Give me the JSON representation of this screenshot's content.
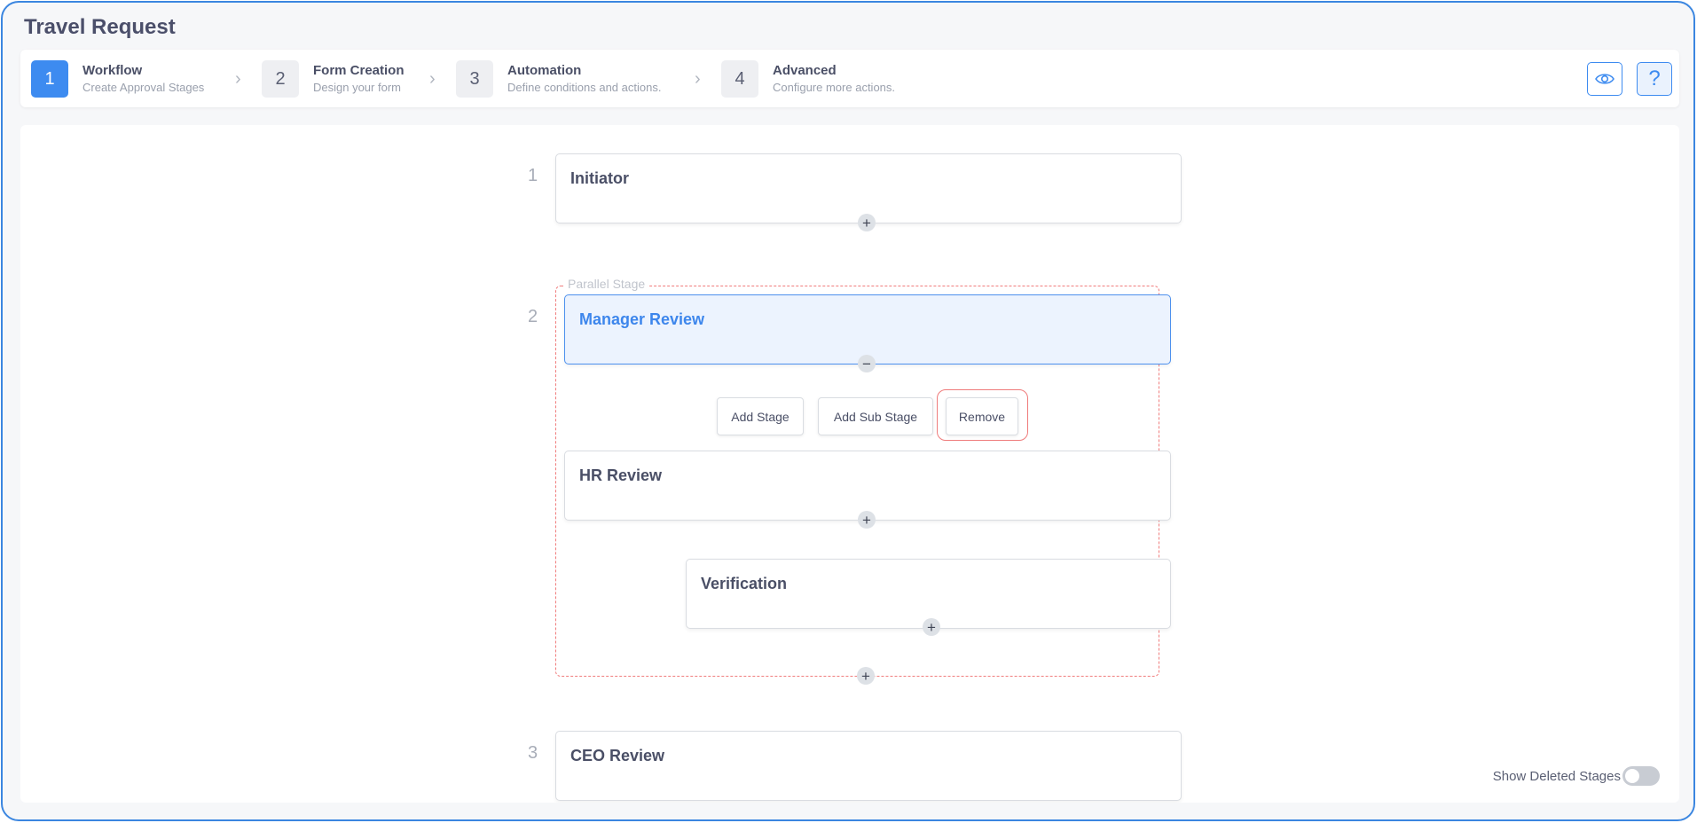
{
  "header": {
    "title": "Travel Request"
  },
  "stepper": {
    "steps": [
      {
        "num": "1",
        "title": "Workflow",
        "subtitle": "Create Approval Stages",
        "active": true
      },
      {
        "num": "2",
        "title": "Form Creation",
        "subtitle": "Design your form",
        "active": false
      },
      {
        "num": "3",
        "title": "Automation",
        "subtitle": "Define conditions and actions.",
        "active": false
      },
      {
        "num": "4",
        "title": "Advanced",
        "subtitle": "Configure more actions.",
        "active": false
      }
    ],
    "chevron": "›",
    "preview_icon": "eye-icon",
    "help_icon": "question-icon",
    "help_glyph": "?"
  },
  "workflow": {
    "stages": [
      {
        "index": "1",
        "title": "Initiator"
      },
      {
        "index": "2",
        "parallel_label": "Parallel Stage",
        "children": [
          {
            "title": "Manager Review",
            "selected": true
          },
          {
            "title": "HR Review"
          },
          {
            "title": "Verification",
            "sub_stage": true
          }
        ]
      },
      {
        "index": "3",
        "title": "CEO Review"
      }
    ],
    "actions": {
      "add_stage": "Add Stage",
      "add_sub_stage": "Add Sub Stage",
      "remove": "Remove"
    },
    "plus_glyph": "+",
    "minus_glyph": "−"
  },
  "footer": {
    "show_deleted_label": "Show Deleted Stages",
    "show_deleted_on": false
  },
  "colors": {
    "accent": "#3d8bf0",
    "danger_outline": "#ef7b7b",
    "selected_bg": "#ecf3fe"
  }
}
